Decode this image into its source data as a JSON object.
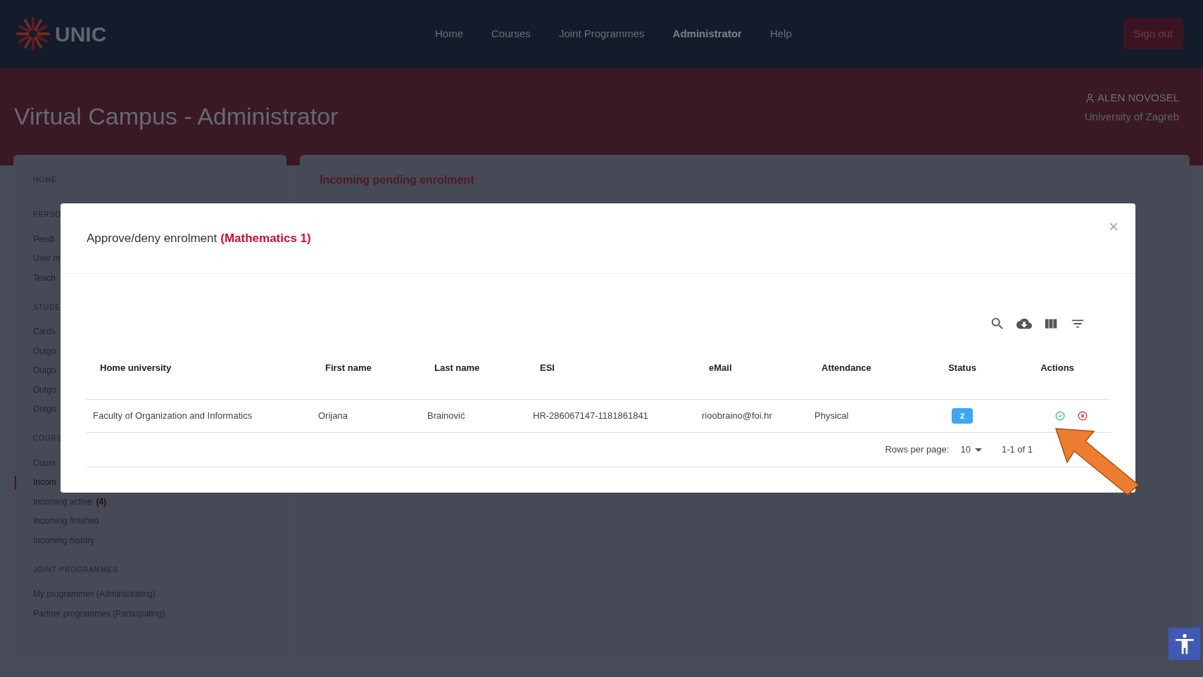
{
  "top_bar": {
    "logo": "UNIC",
    "nav": [
      {
        "label": "Home",
        "selected": false
      },
      {
        "label": "Courses",
        "selected": false
      },
      {
        "label": "Joint Programmes",
        "selected": false
      },
      {
        "label": "Administrator",
        "selected": true
      },
      {
        "label": "Help",
        "selected": false
      }
    ],
    "sign_out": "Sign out"
  },
  "header": {
    "title": "Virtual Campus - Administrator",
    "user_name": "ALEN NOVOSEL",
    "university": "University of Zagreb"
  },
  "sidebar": {
    "sections": [
      {
        "heading": "HOME"
      },
      {
        "heading": "PERSO",
        "items": [
          {
            "label": "Pendi",
            "selected": false
          },
          {
            "label": "User m",
            "selected": false
          },
          {
            "label": "Teach",
            "selected": false
          }
        ]
      },
      {
        "heading": "STUDE",
        "items": [
          {
            "label": "Cards",
            "selected": false
          },
          {
            "label": "Outgo",
            "selected": false
          },
          {
            "label": "Outgo",
            "selected": false
          },
          {
            "label": "Outgo",
            "selected": false
          },
          {
            "label": "Outgo",
            "selected": false
          }
        ]
      },
      {
        "heading": "COURS",
        "items": [
          {
            "label": "Cours",
            "selected": false
          },
          {
            "label": "Incom",
            "selected": true
          },
          {
            "label": "Incoming active",
            "count": "(4)",
            "selected": false
          },
          {
            "label": "Incoming finished",
            "selected": false
          },
          {
            "label": "Incoming history",
            "selected": false
          }
        ]
      },
      {
        "heading": "JOINT PROGRAMMES",
        "items": [
          {
            "label": "My programmes (Administrating)",
            "selected": false
          },
          {
            "label": "Partner programmes (Participating)",
            "selected": false
          }
        ]
      }
    ]
  },
  "main_card": {
    "title": "Incoming pending enrolment"
  },
  "modal": {
    "title": "Approve/deny enrolment",
    "course": "(Mathematics 1)",
    "table": {
      "columns": [
        "Home university",
        "First name",
        "Last name",
        "ESI",
        "eMail",
        "Attendance",
        "Status",
        "Actions"
      ],
      "rows": [
        {
          "cells": [
            "Faculty of Organization and Informatics",
            "Orijana",
            "Brainović",
            "HR-286067147-1181861841",
            "rioobraino@foi.hr",
            "Physical"
          ],
          "status": "2"
        }
      ]
    },
    "pagination": {
      "rows_per_page_label": "Rows per page:",
      "rows_per_page": "10",
      "range": "1-1 of 1"
    }
  }
}
